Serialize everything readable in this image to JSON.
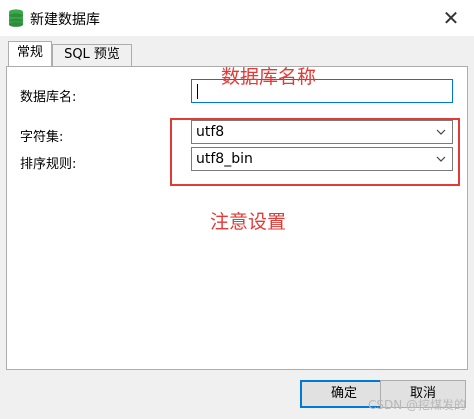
{
  "window": {
    "title": "新建数据库",
    "icon": "database-icon",
    "close_glyph": "✕"
  },
  "tabs": [
    {
      "label": "常规",
      "active": true
    },
    {
      "label": "SQL 预览",
      "active": false
    }
  ],
  "form": {
    "db_name_label": "数据库名:",
    "db_name_value": "",
    "charset_label": "字符集:",
    "charset_value": "utf8",
    "collation_label": "排序规则:",
    "collation_value": "utf8_bin"
  },
  "annotations": {
    "db_name_note": "数据库名称",
    "settings_note": "注意设置",
    "color": "#e53935"
  },
  "buttons": {
    "ok": "确定",
    "cancel": "取消"
  },
  "watermark": "CSDN @挖煤发的"
}
